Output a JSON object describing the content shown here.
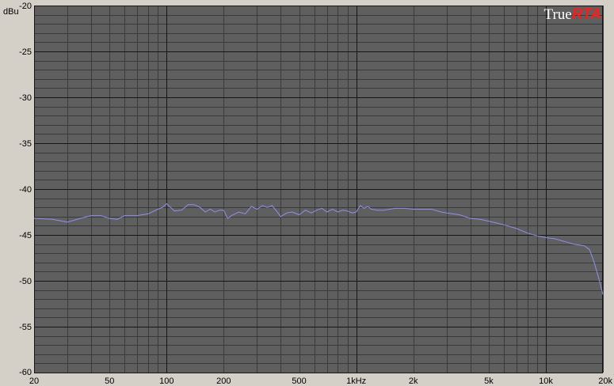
{
  "brand": {
    "prefix": "True",
    "suffix": "RTA"
  },
  "colors": {
    "plot_background": "#5f5f5f",
    "grid_minor": "#3a3a3a",
    "grid_major": "#161616",
    "trace": "#8f8ff0",
    "window_background": "#d4d0c8",
    "brand_suffix": "#ff1a1a"
  },
  "chart_data": {
    "type": "line",
    "title": "",
    "xlabel": "",
    "ylabel": "dBu",
    "x_scale": "log",
    "xlim": [
      20,
      20000
    ],
    "ylim": [
      -60,
      -20
    ],
    "grid": true,
    "y_ticks": [
      {
        "value": -20,
        "label": "-20"
      },
      {
        "value": -25,
        "label": "-25"
      },
      {
        "value": -30,
        "label": "-30"
      },
      {
        "value": -35,
        "label": "-35"
      },
      {
        "value": -40,
        "label": "-40"
      },
      {
        "value": -45,
        "label": "-45"
      },
      {
        "value": -50,
        "label": "-50"
      },
      {
        "value": -55,
        "label": "-55"
      },
      {
        "value": -60,
        "label": "-60"
      }
    ],
    "x_ticks": [
      {
        "value": 20,
        "label": "20"
      },
      {
        "value": 50,
        "label": "50"
      },
      {
        "value": 100,
        "label": "100"
      },
      {
        "value": 200,
        "label": "200"
      },
      {
        "value": 500,
        "label": "500"
      },
      {
        "value": 1000,
        "label": "1kHz"
      },
      {
        "value": 2000,
        "label": "2k"
      },
      {
        "value": 5000,
        "label": "5k"
      },
      {
        "value": 10000,
        "label": "10k"
      },
      {
        "value": 20000,
        "label": "20k"
      }
    ],
    "series": [
      {
        "x": [
          20,
          25,
          30,
          35,
          40,
          45,
          50,
          55,
          60,
          70,
          80,
          90,
          95,
          100,
          105,
          110,
          120,
          130,
          140,
          150,
          160,
          170,
          180,
          190,
          200,
          210,
          220,
          240,
          260,
          280,
          300,
          320,
          340,
          360,
          380,
          400,
          430,
          460,
          500,
          540,
          580,
          620,
          660,
          700,
          750,
          800,
          850,
          900,
          950,
          1000,
          1050,
          1100,
          1150,
          1200,
          1300,
          1400,
          1500,
          1600,
          1800,
          2000,
          2200,
          2500,
          2800,
          3000,
          3500,
          4000,
          4500,
          5000,
          5500,
          6000,
          7000,
          8000,
          9000,
          10000,
          11000,
          12000,
          13000,
          14000,
          15000,
          16000,
          17000,
          18000,
          19000,
          20000
        ],
        "y": [
          -43.2,
          -43.3,
          -43.6,
          -43.2,
          -42.9,
          -42.9,
          -43.2,
          -43.3,
          -42.9,
          -42.9,
          -42.7,
          -42.2,
          -42.0,
          -41.6,
          -42.0,
          -42.4,
          -42.3,
          -41.7,
          -41.7,
          -42.0,
          -42.5,
          -42.2,
          -42.5,
          -42.3,
          -42.3,
          -43.2,
          -42.9,
          -42.5,
          -42.7,
          -41.9,
          -42.2,
          -41.8,
          -42.0,
          -41.8,
          -42.4,
          -43.0,
          -42.6,
          -42.5,
          -42.8,
          -42.3,
          -42.6,
          -42.3,
          -42.1,
          -42.5,
          -42.2,
          -42.5,
          -42.3,
          -42.4,
          -42.6,
          -42.5,
          -41.8,
          -42.1,
          -41.9,
          -42.2,
          -42.3,
          -42.3,
          -42.2,
          -42.1,
          -42.1,
          -42.2,
          -42.2,
          -42.2,
          -42.5,
          -42.6,
          -42.8,
          -43.2,
          -43.3,
          -43.5,
          -43.7,
          -43.9,
          -44.3,
          -44.8,
          -45.1,
          -45.3,
          -45.4,
          -45.6,
          -45.8,
          -46.0,
          -46.1,
          -46.2,
          -46.6,
          -48.0,
          -49.7,
          -51.5
        ]
      }
    ]
  }
}
